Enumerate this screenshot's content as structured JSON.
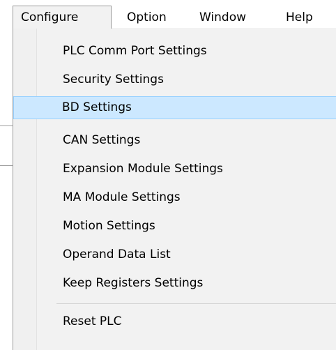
{
  "menubar": {
    "items": [
      {
        "label": "Configure",
        "open": true
      },
      {
        "label": "Option",
        "open": false
      },
      {
        "label": "Window",
        "open": false
      },
      {
        "label": "Help",
        "open": false
      }
    ]
  },
  "dropdown": {
    "items": [
      {
        "label": "PLC Comm Port Settings"
      },
      {
        "label": "Security Settings"
      },
      {
        "label": "BD Settings",
        "highlighted": true
      },
      {
        "label": "CAN Settings"
      },
      {
        "label": "Expansion Module Settings"
      },
      {
        "label": "MA Module Settings"
      },
      {
        "label": "Motion Settings"
      },
      {
        "label": "Operand Data List"
      },
      {
        "label": "Keep Registers Settings"
      },
      {
        "label": "Reset PLC"
      }
    ]
  },
  "colors": {
    "highlight_bg": "#cce8ff",
    "highlight_border": "#99d1ff",
    "menu_bg": "#f2f2f2"
  }
}
